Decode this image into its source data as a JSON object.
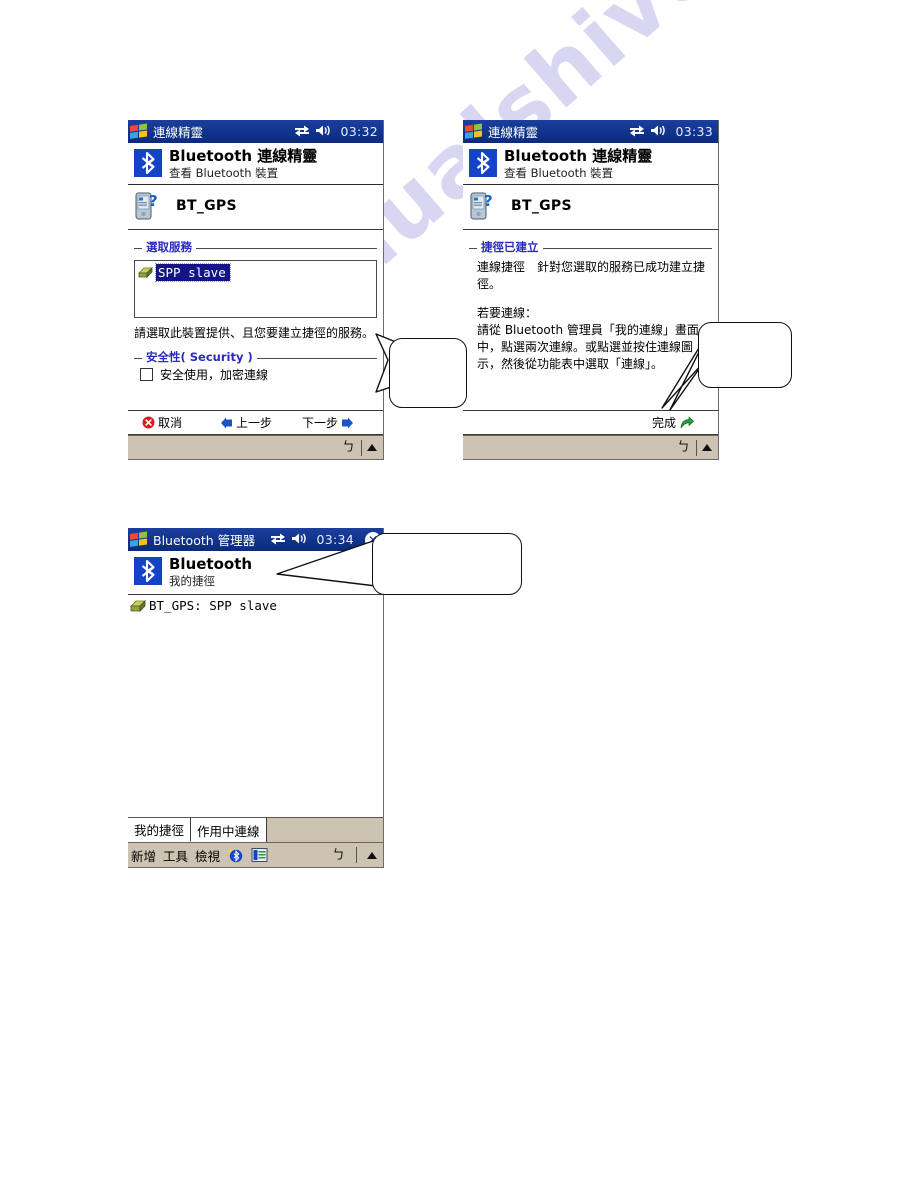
{
  "page": {
    "background": "#ffffff",
    "watermark_text": "manualshive.com",
    "watermark_color": "#b9b6e6"
  },
  "colors": {
    "titlebar_blue": "#12358e",
    "bluetooth_blue": "#1543c8",
    "group_label_blue": "#2b2bbd",
    "selection_blue": "#141489",
    "taskbar_tan": "#cdc3b2"
  },
  "screens": [
    {
      "id": "connection-wizard-select-service",
      "titlebar": {
        "title": "連線精靈",
        "time": "03:32",
        "icons": [
          "windows-flag-icon",
          "connectivity-icon",
          "speaker-icon"
        ],
        "has_close": false
      },
      "app_header": {
        "title": "Bluetooth 連線精靈",
        "subtitle": "查看 Bluetooth 裝置",
        "icon": "bluetooth-logo-icon"
      },
      "device": {
        "name": "BT_GPS",
        "icon": "pda-device-icon"
      },
      "group": {
        "label": "選取服務",
        "list_items": [
          {
            "text": "SPP slave",
            "selected": true,
            "icon": "service-plug-icon"
          }
        ],
        "hint": "請選取此裝置提供、且您要建立捷徑的服務。"
      },
      "security_group": {
        "label": "安全性( Security )",
        "checkbox": {
          "label": "安全使用，加密連線",
          "checked": false
        }
      },
      "commandbar": [
        {
          "label": "取消",
          "icon": "cancel-red-x-icon",
          "icon_side": "left"
        },
        {
          "label": "上一步",
          "icon": "back-arrow-blue-icon",
          "icon_side": "left"
        },
        {
          "label": "下一步",
          "icon": "next-arrow-blue-icon",
          "icon_side": "right"
        }
      ],
      "sipbar": {
        "keyboard_glyph": "ㄅ",
        "arrow": "up-arrow-icon"
      }
    },
    {
      "id": "connection-wizard-shortcut-created",
      "titlebar": {
        "title": "連線精靈",
        "time": "03:33",
        "icons": [
          "windows-flag-icon",
          "connectivity-icon",
          "speaker-icon"
        ],
        "has_close": false
      },
      "app_header": {
        "title": "Bluetooth 連線精靈",
        "subtitle": "查看 Bluetooth 裝置",
        "icon": "bluetooth-logo-icon"
      },
      "device": {
        "name": "BT_GPS",
        "icon": "pda-device-icon"
      },
      "group": {
        "label": "捷徑已建立",
        "paragraphs": [
          "連線捷徑　針對您選取的服務已成功建立捷徑。",
          "若要連線：",
          "請從 Bluetooth 管理員「我的連線」畫面中，點選兩次連線。或點選並按住連線圖示，然後從功能表中選取「連線」。"
        ]
      },
      "commandbar": [
        {
          "label": "完成",
          "icon": "finish-green-arrow-icon",
          "icon_side": "right"
        }
      ],
      "sipbar": {
        "keyboard_glyph": "ㄅ",
        "arrow": "up-arrow-icon"
      }
    },
    {
      "id": "bluetooth-manager",
      "titlebar": {
        "title": "Bluetooth 管理器",
        "time": "03:34",
        "icons": [
          "windows-flag-icon",
          "connectivity-icon",
          "speaker-icon"
        ],
        "has_close": true,
        "close_label": "✕"
      },
      "app_header": {
        "title": "Bluetooth",
        "subtitle": "我的捷徑",
        "icon": "bluetooth-logo-icon"
      },
      "list_items": [
        {
          "text": "BT_GPS: SPP slave",
          "icon": "service-plug-icon"
        }
      ],
      "tabs": [
        {
          "label": "我的捷徑",
          "active": true
        },
        {
          "label": "作用中連線",
          "active": false
        }
      ],
      "toolbar": [
        {
          "label": "新增"
        },
        {
          "label": "工具"
        },
        {
          "label": "檢視"
        }
      ],
      "toolbar_icons": [
        "bluetooth-sparkle-icon",
        "properties-list-icon"
      ],
      "sipbar": {
        "keyboard_glyph": "ㄅ",
        "arrow": "up-arrow-icon"
      }
    }
  ],
  "callouts": [
    {
      "id": "callout-next-step",
      "text": ""
    },
    {
      "id": "callout-finish",
      "text": ""
    },
    {
      "id": "callout-my-shortcuts",
      "text": ""
    }
  ]
}
